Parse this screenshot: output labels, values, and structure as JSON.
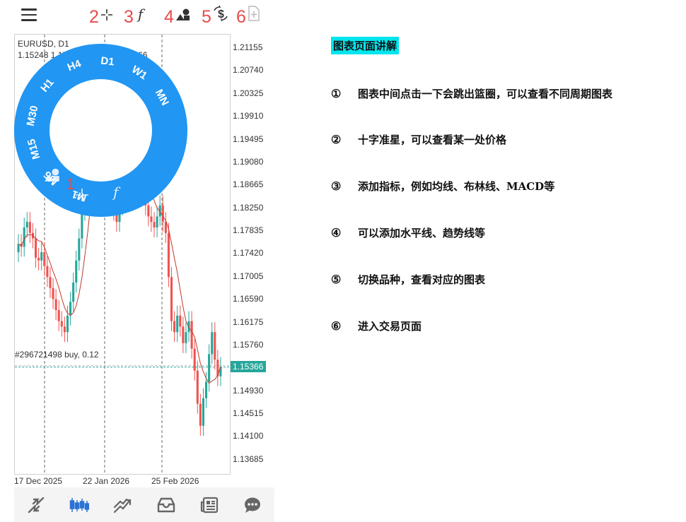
{
  "toolbar": {
    "buttons": [
      {
        "num": "2",
        "icon": "crosshair-icon"
      },
      {
        "num": "3",
        "icon": "function-icon"
      },
      {
        "num": "4",
        "icon": "objects-icon"
      },
      {
        "num": "5",
        "icon": "symbol-switch-icon"
      },
      {
        "num": "6",
        "icon": "new-order-icon"
      }
    ],
    "function_glyph": "f"
  },
  "chart": {
    "symbol": "EURUSD, D1",
    "ohlc": "1.15248 1.15400 1.15138 1.15366",
    "trade_line": "#296721498 buy, 0.12",
    "current_price": "1.15366",
    "price_ticks": [
      "1.21155",
      "1.20740",
      "1.20325",
      "1.19910",
      "1.19495",
      "1.19080",
      "1.18665",
      "1.18250",
      "1.17835",
      "1.17420",
      "1.17005",
      "1.16590",
      "1.16175",
      "1.15760",
      "1.14930",
      "1.14515",
      "1.14100",
      "1.13685"
    ],
    "time_ticks": [
      "17 Dec 2025",
      "22 Jan 2026",
      "25 Feb 2026"
    ],
    "colors": {
      "up": "#26a69a",
      "down": "#ef5350",
      "ma": "#c0392b",
      "ring": "#2196f3",
      "tag": "#26a69a"
    }
  },
  "chart_data": {
    "type": "bar",
    "title": "EURUSD, D1",
    "xlabel": "",
    "ylabel": "",
    "ylim": [
      1.134,
      1.214
    ],
    "categories": [
      "17 Dec 2025",
      "22 Jan 2026",
      "25 Feb 2026"
    ],
    "current_price": 1.15366
  },
  "ring": {
    "periods": [
      "M1",
      "M5",
      "M15",
      "M30",
      "H1",
      "H4",
      "D1",
      "W1",
      "MN"
    ],
    "number": "1",
    "function_glyph": "f"
  },
  "bottom_nav": [
    "quotes-icon",
    "chart-icon",
    "trade-icon",
    "history-icon",
    "news-icon",
    "messages-icon"
  ],
  "panel": {
    "title": "图表页面讲解",
    "items": [
      {
        "num": "①",
        "text": "图表中间点击一下会跳出篮圈，可以查看不同周期图表"
      },
      {
        "num": "②",
        "text": "十字准星，可以查看某一处价格"
      },
      {
        "num": "③",
        "text": "添加指标，例如均线、布林线、MACD等"
      },
      {
        "num": "④",
        "text": "可以添加水平线、趋势线等"
      },
      {
        "num": "⑤",
        "text": "切换品种，查看对应的图表"
      },
      {
        "num": "⑥",
        "text": "进入交易页面"
      }
    ]
  }
}
